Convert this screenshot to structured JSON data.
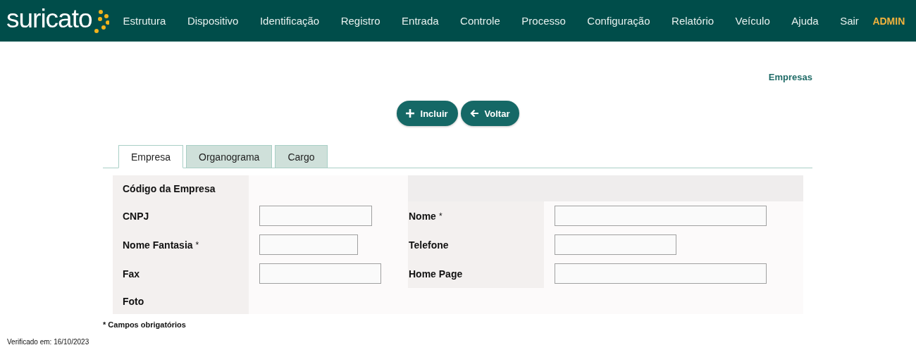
{
  "header": {
    "logo": "suricato",
    "menu": [
      {
        "label": "Estrutura"
      },
      {
        "label": "Dispositivo"
      },
      {
        "label": "Identificação"
      },
      {
        "label": "Registro"
      },
      {
        "label": "Entrada"
      },
      {
        "label": "Controle"
      },
      {
        "label": "Processo"
      },
      {
        "label": "Configuração"
      },
      {
        "label": "Relatório"
      },
      {
        "label": "Veículo"
      },
      {
        "label": "Ajuda"
      },
      {
        "label": "Sair"
      }
    ],
    "user": "ADMIN"
  },
  "page_title": "Empresas",
  "buttons": [
    {
      "label": "Incluir",
      "kind": "add"
    },
    {
      "label": "Voltar",
      "kind": "back"
    }
  ],
  "tabs": [
    {
      "label": "Empresa",
      "selected": true
    },
    {
      "label": "Organograma",
      "selected": false
    },
    {
      "label": "Cargo",
      "selected": false
    }
  ],
  "form": {
    "left": [
      {
        "label": "Código da Empresa",
        "kind": "readonly"
      },
      {
        "label": "CNPJ",
        "kind": "input"
      },
      {
        "label": "Nome Fantasia",
        "required_mark": "*",
        "kind": "input"
      },
      {
        "label": "Fax",
        "kind": "input"
      },
      {
        "label": "Foto",
        "kind": "readonly"
      }
    ],
    "right": [
      {
        "label": "Nome",
        "required_mark": "*",
        "kind": "input"
      },
      {
        "label": "Telefone",
        "kind": "input"
      },
      {
        "label": "Home Page",
        "kind": "input"
      }
    ]
  },
  "required_note": "* Campos obrigatórios",
  "verified": "Verificado em: 16/10/2023"
}
